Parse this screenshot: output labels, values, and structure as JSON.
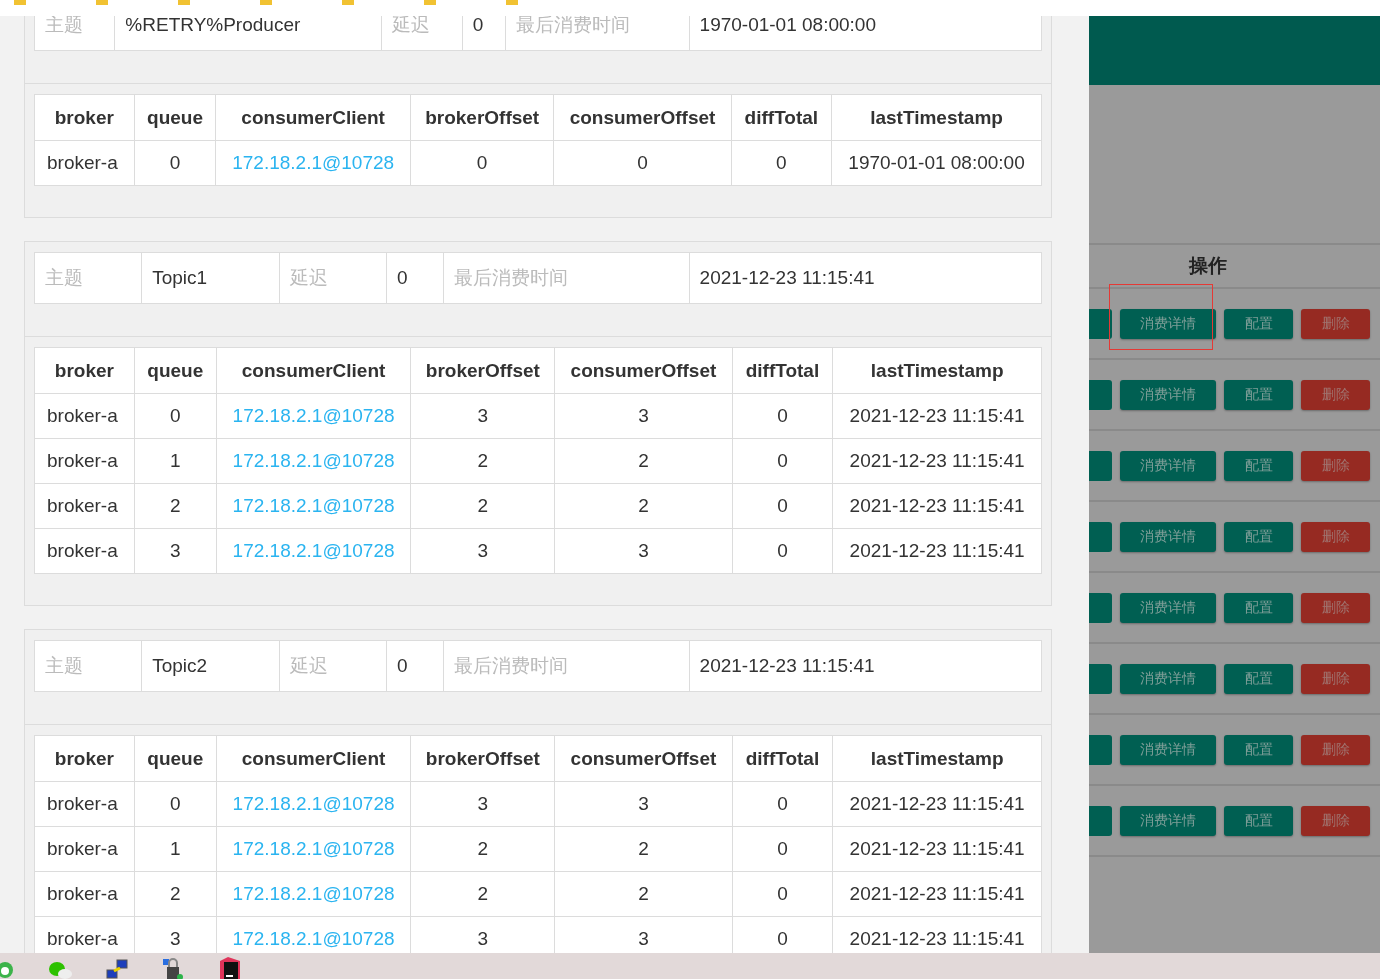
{
  "groups": [
    {
      "info": {
        "topic_label": "主题",
        "topic": "%RETRY%Producer",
        "delay_label": "延迟",
        "delay": "0",
        "last_label": "最后消费时间",
        "last": "1970-01-01 08:00:00"
      },
      "columns": [
        "broker",
        "queue",
        "consumerClient",
        "brokerOffset",
        "consumerOffset",
        "diffTotal",
        "lastTimestamp"
      ],
      "rows": [
        [
          "broker-a",
          "0",
          "172.18.2.1@10728",
          "0",
          "0",
          "0",
          "1970-01-01 08:00:00"
        ]
      ]
    },
    {
      "info": {
        "topic_label": "主题",
        "topic": "Topic1",
        "delay_label": "延迟",
        "delay": "0",
        "last_label": "最后消费时间",
        "last": "2021-12-23 11:15:41"
      },
      "columns": [
        "broker",
        "queue",
        "consumerClient",
        "brokerOffset",
        "consumerOffset",
        "diffTotal",
        "lastTimestamp"
      ],
      "rows": [
        [
          "broker-a",
          "0",
          "172.18.2.1@10728",
          "3",
          "3",
          "0",
          "2021-12-23 11:15:41"
        ],
        [
          "broker-a",
          "1",
          "172.18.2.1@10728",
          "2",
          "2",
          "0",
          "2021-12-23 11:15:41"
        ],
        [
          "broker-a",
          "2",
          "172.18.2.1@10728",
          "2",
          "2",
          "0",
          "2021-12-23 11:15:41"
        ],
        [
          "broker-a",
          "3",
          "172.18.2.1@10728",
          "3",
          "3",
          "0",
          "2021-12-23 11:15:41"
        ]
      ]
    },
    {
      "info": {
        "topic_label": "主题",
        "topic": "Topic2",
        "delay_label": "延迟",
        "delay": "0",
        "last_label": "最后消费时间",
        "last": "2021-12-23 11:15:41"
      },
      "columns": [
        "broker",
        "queue",
        "consumerClient",
        "brokerOffset",
        "consumerOffset",
        "diffTotal",
        "lastTimestamp"
      ],
      "rows": [
        [
          "broker-a",
          "0",
          "172.18.2.1@10728",
          "3",
          "3",
          "0",
          "2021-12-23 11:15:41"
        ],
        [
          "broker-a",
          "1",
          "172.18.2.1@10728",
          "2",
          "2",
          "0",
          "2021-12-23 11:15:41"
        ],
        [
          "broker-a",
          "2",
          "172.18.2.1@10728",
          "2",
          "2",
          "0",
          "2021-12-23 11:15:41"
        ],
        [
          "broker-a",
          "3",
          "172.18.2.1@10728",
          "3",
          "3",
          "0",
          "2021-12-23 11:15:41"
        ]
      ]
    }
  ],
  "operations": {
    "header": "操作",
    "rows": [
      {
        "buttons": [
          "消费详情",
          "配置",
          "删除"
        ],
        "highlighted": true
      },
      {
        "buttons": [
          "消费详情",
          "配置",
          "删除"
        ],
        "highlighted": false
      },
      {
        "buttons": [
          "消费详情",
          "配置",
          "删除"
        ],
        "highlighted": false
      },
      {
        "buttons": [
          "消费详情",
          "配置",
          "删除"
        ],
        "highlighted": false
      },
      {
        "buttons": [
          "消费详情",
          "配置",
          "删除"
        ],
        "highlighted": false
      },
      {
        "buttons": [
          "消费详情",
          "配置",
          "删除"
        ],
        "highlighted": false
      },
      {
        "buttons": [
          "消费详情",
          "配置",
          "删除"
        ],
        "highlighted": false
      },
      {
        "buttons": [
          "消费详情",
          "配置",
          "删除"
        ],
        "highlighted": false
      }
    ]
  }
}
